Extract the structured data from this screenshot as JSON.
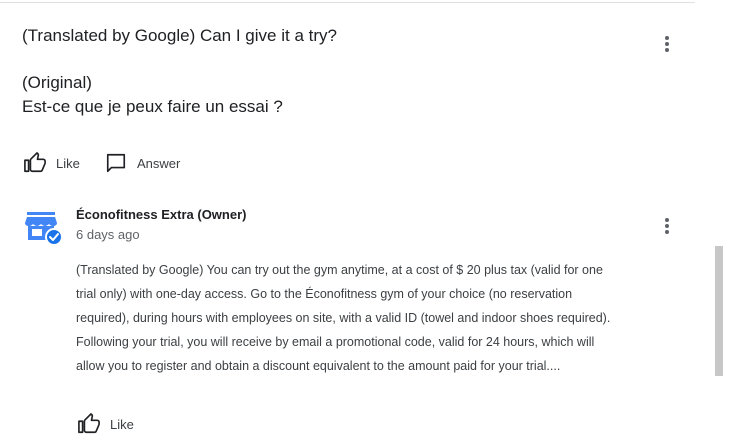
{
  "question": {
    "translated_text": "(Translated by Google) Can I give it a try?",
    "original_label": "(Original)",
    "original_text": "Est-ce que je peux faire un essai ?"
  },
  "question_actions": {
    "like_label": "Like",
    "answer_label": "Answer"
  },
  "owner_reply": {
    "name": "Éconofitness Extra (Owner)",
    "date": "6 days ago",
    "lines": [
      "(Translated by Google) You can try out the gym anytime, at a cost of $ 20 plus tax (valid for one",
      "trial only) with one-day access. Go to the Éconofitness gym of your choice (no reservation",
      "required), during hours with employees on site, with a valid ID (towel and indoor shoes required).",
      "Following your trial, you will receive by email a promotional code, valid for 24 hours, which will",
      "allow you to register and obtain a discount equivalent to the amount paid for your trial...."
    ],
    "like_label": "Like"
  },
  "colors": {
    "store_icon": "#4285f4",
    "verified_badge": "#1a73e8",
    "icon_gray": "#5f6368",
    "text": "#202124"
  }
}
